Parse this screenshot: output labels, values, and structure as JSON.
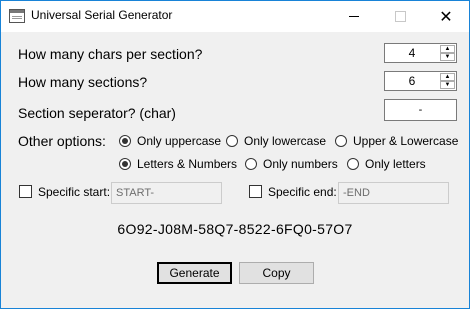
{
  "window": {
    "title": "Universal Serial Generator"
  },
  "form": {
    "chars_label": "How many chars per section?",
    "chars_value": "4",
    "sections_label": "How many sections?",
    "sections_value": "6",
    "separator_label": "Section seperator? (char)",
    "separator_value": "-",
    "options_label": "Other options:",
    "case_options": [
      {
        "label": "Only uppercase",
        "checked": true
      },
      {
        "label": "Only lowercase",
        "checked": false
      },
      {
        "label": "Upper & Lowercase",
        "checked": false
      }
    ],
    "type_options": [
      {
        "label": "Letters & Numbers",
        "checked": true
      },
      {
        "label": "Only numbers",
        "checked": false
      },
      {
        "label": "Only letters",
        "checked": false
      }
    ],
    "specific_start": {
      "label": "Specific start:",
      "placeholder": "START-",
      "checked": false
    },
    "specific_end": {
      "label": "Specific end:",
      "placeholder": "-END",
      "checked": false
    }
  },
  "result": {
    "serial": "6O92-J08M-58Q7-8522-6FQ0-57O7"
  },
  "buttons": {
    "generate": "Generate",
    "copy": "Copy"
  }
}
